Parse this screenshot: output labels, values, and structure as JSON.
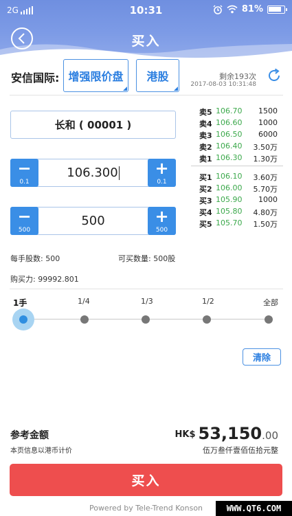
{
  "status_bar": {
    "network": "2G",
    "time": "10:31",
    "battery": "81%"
  },
  "header": {
    "title": "买入"
  },
  "broker": {
    "name": "安信国际:",
    "order_type": "增强限价盘",
    "market": "港股",
    "remaining": "剩余193次",
    "timestamp": "2017-08-03 10:31:48"
  },
  "stock": {
    "label": "长和 ( 00001 )"
  },
  "price": {
    "value": "106.300",
    "step": "0.1"
  },
  "quantity": {
    "value": "500",
    "step": "500"
  },
  "info": {
    "lot_size_label": "每手股数:",
    "lot_size": "500",
    "buyable_label": "可买数量:",
    "buyable": "500股",
    "buying_power_label": "购买力:",
    "buying_power": "99992.801"
  },
  "order_book": {
    "asks": [
      {
        "label": "卖5",
        "price": "106.70",
        "volume": "1500"
      },
      {
        "label": "卖4",
        "price": "106.60",
        "volume": "1000"
      },
      {
        "label": "卖3",
        "price": "106.50",
        "volume": "6000"
      },
      {
        "label": "卖2",
        "price": "106.40",
        "volume": "3.50万"
      },
      {
        "label": "卖1",
        "price": "106.30",
        "volume": "1.30万"
      }
    ],
    "bids": [
      {
        "label": "买1",
        "price": "106.10",
        "volume": "3.60万"
      },
      {
        "label": "买2",
        "price": "106.00",
        "volume": "5.70万"
      },
      {
        "label": "买3",
        "price": "105.90",
        "volume": "1000"
      },
      {
        "label": "买4",
        "price": "105.80",
        "volume": "4.80万"
      },
      {
        "label": "买5",
        "price": "105.70",
        "volume": "1.50万"
      }
    ]
  },
  "slider": {
    "labels": [
      "1手",
      "1/4",
      "1/3",
      "1/2",
      "全部"
    ],
    "selected": 0
  },
  "clear_label": "清除",
  "amount": {
    "title": "参考金额",
    "note": "本页信息以港币计价",
    "currency": "HK$",
    "value": "53,150",
    "decimals": ".00",
    "chinese": "伍万叁仟壹佰伍拾元整"
  },
  "buy_label": "买入",
  "powered_by": "Powered by Tele-Trend Konson",
  "watermark": "WWW.QT6.COM",
  "colors": {
    "accent": "#3a8ee6",
    "buy": "#ee4e4e",
    "price_green": "#3aa84a"
  }
}
